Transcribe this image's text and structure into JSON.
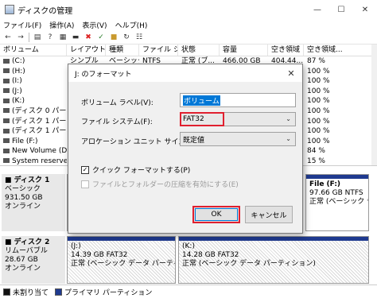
{
  "window": {
    "title": "ディスクの管理"
  },
  "menu": [
    "ファイル(F)",
    "操作(A)",
    "表示(V)",
    "ヘルプ(H)"
  ],
  "toolbar_icons": [
    "back-arrow-icon",
    "forward-arrow-icon",
    "list-view-icon",
    "help-icon",
    "properties-icon",
    "connect-icon",
    "delete-icon",
    "check-icon",
    "folder-icon",
    "refresh-icon",
    "details-icon"
  ],
  "list": {
    "headers": [
      "ボリューム",
      "レイアウト",
      "種類",
      "ファイル システム",
      "状態",
      "容量",
      "空き領域",
      "空き領域..."
    ],
    "rows": [
      [
        "(C:)",
        "シンプル",
        "ベーシック",
        "NTFS",
        "正常 (ブ...",
        "466.00 GB",
        "404.44...",
        "87 %"
      ],
      [
        "(H:)",
        "",
        "",
        "",
        "",
        "",
        "",
        "100 %"
      ],
      [
        "(I:)",
        "",
        "",
        "",
        "",
        "",
        "",
        "100 %"
      ],
      [
        "(J:)",
        "",
        "",
        "",
        "",
        "",
        "",
        "100 %"
      ],
      [
        "(K:)",
        "",
        "",
        "",
        "",
        "",
        "",
        "100 %"
      ],
      [
        "(ディスク 0 パーテ...",
        "",
        "",
        "",
        "",
        "",
        "",
        "100 %"
      ],
      [
        "(ディスク 1 パーテ...",
        "",
        "",
        "",
        "",
        "",
        "",
        "100 %"
      ],
      [
        "(ディスク 1 パーテ...",
        "",
        "",
        "",
        "",
        "",
        "",
        "100 %"
      ],
      [
        "File (F:)",
        "",
        "",
        "",
        "",
        "",
        "",
        "100 %"
      ],
      [
        "New Volume (D:)",
        "",
        "",
        "",
        "",
        "",
        "",
        "84 %"
      ],
      [
        "System reserve...",
        "",
        "",
        "",
        "",
        "",
        "",
        "15 %"
      ]
    ]
  },
  "disks": {
    "disk1": {
      "title": "ディスク 1",
      "type": "ベーシック",
      "size": "931.50 GB",
      "status": "オンライン"
    },
    "disk1_part_left": {
      "line1": "正",
      "line2": ""
    },
    "disk1_part_right": {
      "name": "File (F:)",
      "size": "97.66 GB NTFS",
      "status": "正常 (ベーシック デ"
    },
    "disk2": {
      "title": "ディスク 2",
      "type": "リムーバブル",
      "size": "28.67 GB",
      "status": "オンライン"
    },
    "disk2_part_left": {
      "name": "(J:)",
      "size": "14.39 GB FAT32",
      "status": "正常 (ベーシック データ パーティション)"
    },
    "disk2_part_right": {
      "name": "(K:)",
      "size": "14.28 GB FAT32",
      "status": "正常 (ベーシック データ パーティション)"
    }
  },
  "legend": {
    "unallocated": "未割り当て",
    "primary": "プライマリ パーティション"
  },
  "colors": {
    "unallocated": "#111111",
    "primary": "#1f3a8f",
    "highlight": "#e0202f"
  },
  "dialog": {
    "title": "J: のフォーマット",
    "volume_label_label": "ボリューム ラベル(V):",
    "volume_label_value": "ボリューム",
    "filesystem_label": "ファイル システム(F):",
    "filesystem_value": "FAT32",
    "allocation_label": "アロケーション ユニット サイズ(A):",
    "allocation_value": "既定値",
    "quick_format_label": "クイック フォーマットする(P)",
    "quick_format_checked": true,
    "compression_label": "ファイルとフォルダーの圧縮を有効にする(E)",
    "compression_checked": false,
    "ok_label": "OK",
    "cancel_label": "キャンセル"
  }
}
